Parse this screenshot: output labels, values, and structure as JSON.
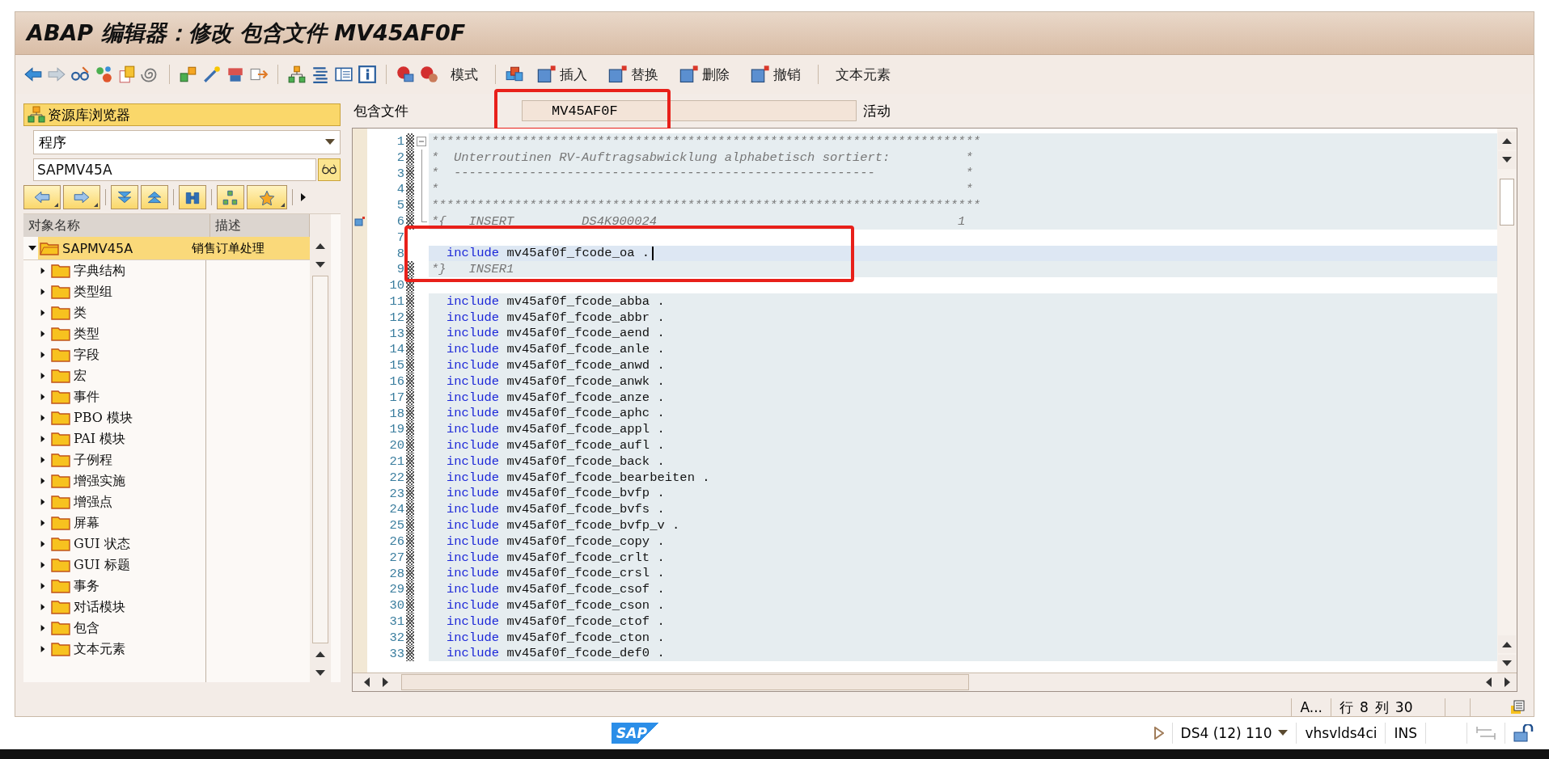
{
  "window": {
    "title": "ABAP 编辑器：修改 包含文件 MV45AF0F"
  },
  "toolbar": {
    "buttons": [
      {
        "kind": "text",
        "label": "模式"
      },
      {
        "kind": "icon_text",
        "label": "插入"
      },
      {
        "kind": "icon_text",
        "label": "替换"
      },
      {
        "kind": "icon_text",
        "label": "删除"
      },
      {
        "kind": "icon_text",
        "label": "撤销"
      },
      {
        "kind": "text",
        "label": "文本元素"
      }
    ]
  },
  "repository_browser": {
    "title": "资源库浏览器",
    "object_type": "程序",
    "object_name": "SAPMV45A",
    "columns": [
      "对象名称",
      "描述"
    ],
    "tree": [
      {
        "label": "SAPMV45A",
        "description": "销售订单处理",
        "expanded": true,
        "selected": true,
        "children": [
          {
            "label": "字典结构",
            "expanded": false,
            "selected": false
          },
          {
            "label": "类型组",
            "expanded": false,
            "selected": false
          },
          {
            "label": "类",
            "expanded": false,
            "selected": false
          },
          {
            "label": "类型",
            "expanded": false,
            "selected": false
          },
          {
            "label": "字段",
            "expanded": false,
            "selected": false
          },
          {
            "label": "宏",
            "expanded": false,
            "selected": false
          },
          {
            "label": "事件",
            "expanded": false,
            "selected": false
          },
          {
            "label": "PBO 模块",
            "expanded": false,
            "selected": false
          },
          {
            "label": "PAI 模块",
            "expanded": false,
            "selected": false
          },
          {
            "label": "子例程",
            "expanded": false,
            "selected": false
          },
          {
            "label": "增强实施",
            "expanded": false,
            "selected": false
          },
          {
            "label": "增强点",
            "expanded": false,
            "selected": false
          },
          {
            "label": "屏幕",
            "expanded": false,
            "selected": false
          },
          {
            "label": "GUI 状态",
            "expanded": false,
            "selected": false
          },
          {
            "label": "GUI 标题",
            "expanded": false,
            "selected": false
          },
          {
            "label": "事务",
            "expanded": false,
            "selected": false
          },
          {
            "label": "对话模块",
            "expanded": false,
            "selected": false
          },
          {
            "label": "包含",
            "expanded": false,
            "selected": false
          },
          {
            "label": "文本元素",
            "expanded": false,
            "selected": false
          }
        ]
      }
    ]
  },
  "editor": {
    "field_label": "包含文件",
    "field_value": "MV45AF0F",
    "status": "活动",
    "lines": [
      {
        "number": "1",
        "kind": "comment",
        "text": "*************************************************************************",
        "current": false,
        "modified": false
      },
      {
        "number": "2",
        "kind": "comment",
        "text": "*  Unterroutinen RV-Auftragsabwicklung alphabetisch sortiert:          *",
        "current": false,
        "modified": false
      },
      {
        "number": "3",
        "kind": "comment",
        "text": "*  --------------------------------------------------------            *",
        "current": false,
        "modified": false
      },
      {
        "number": "4",
        "kind": "comment",
        "text": "*                                                                      *",
        "current": false,
        "modified": false
      },
      {
        "number": "5",
        "kind": "comment",
        "text": "*************************************************************************",
        "current": false,
        "modified": false
      },
      {
        "number": "6",
        "kind": "comment",
        "text": "*{   INSERT         DS4K900024                                        1",
        "current": false,
        "modified": false
      },
      {
        "number": "7",
        "kind": "blank",
        "current": false,
        "modified": true
      },
      {
        "number": "8",
        "kind": "include",
        "keyword": "include",
        "text": "mv45af0f_fcode_oa .",
        "current": true,
        "modified": true
      },
      {
        "number": "9",
        "kind": "comment",
        "text": "*}   INSER1",
        "current": false,
        "modified": false
      },
      {
        "number": "10",
        "kind": "blank",
        "current": false,
        "modified": false
      },
      {
        "number": "11",
        "kind": "include",
        "keyword": "include",
        "text": "mv45af0f_fcode_abba .",
        "current": false,
        "modified": false
      },
      {
        "number": "12",
        "kind": "include",
        "keyword": "include",
        "text": "mv45af0f_fcode_abbr .",
        "current": false,
        "modified": false
      },
      {
        "number": "13",
        "kind": "include",
        "keyword": "include",
        "text": "mv45af0f_fcode_aend .",
        "current": false,
        "modified": false
      },
      {
        "number": "14",
        "kind": "include",
        "keyword": "include",
        "text": "mv45af0f_fcode_anle .",
        "current": false,
        "modified": false
      },
      {
        "number": "15",
        "kind": "include",
        "keyword": "include",
        "text": "mv45af0f_fcode_anwd .",
        "current": false,
        "modified": false
      },
      {
        "number": "16",
        "kind": "include",
        "keyword": "include",
        "text": "mv45af0f_fcode_anwk .",
        "current": false,
        "modified": false
      },
      {
        "number": "17",
        "kind": "include",
        "keyword": "include",
        "text": "mv45af0f_fcode_anze .",
        "current": false,
        "modified": false
      },
      {
        "number": "18",
        "kind": "include",
        "keyword": "include",
        "text": "mv45af0f_fcode_aphc .",
        "current": false,
        "modified": false
      },
      {
        "number": "19",
        "kind": "include",
        "keyword": "include",
        "text": "mv45af0f_fcode_appl .",
        "current": false,
        "modified": false
      },
      {
        "number": "20",
        "kind": "include",
        "keyword": "include",
        "text": "mv45af0f_fcode_aufl .",
        "current": false,
        "modified": false
      },
      {
        "number": "21",
        "kind": "include",
        "keyword": "include",
        "text": "mv45af0f_fcode_back .",
        "current": false,
        "modified": false
      },
      {
        "number": "22",
        "kind": "include",
        "keyword": "include",
        "text": "mv45af0f_fcode_bearbeiten .",
        "current": false,
        "modified": false
      },
      {
        "number": "23",
        "kind": "include",
        "keyword": "include",
        "text": "mv45af0f_fcode_bvfp .",
        "current": false,
        "modified": false
      },
      {
        "number": "24",
        "kind": "include",
        "keyword": "include",
        "text": "mv45af0f_fcode_bvfs .",
        "current": false,
        "modified": false
      },
      {
        "number": "25",
        "kind": "include",
        "keyword": "include",
        "text": "mv45af0f_fcode_bvfp_v .",
        "current": false,
        "modified": false
      },
      {
        "number": "26",
        "kind": "include",
        "keyword": "include",
        "text": "mv45af0f_fcode_copy .",
        "current": false,
        "modified": false
      },
      {
        "number": "27",
        "kind": "include",
        "keyword": "include",
        "text": "mv45af0f_fcode_crlt .",
        "current": false,
        "modified": false
      },
      {
        "number": "28",
        "kind": "include",
        "keyword": "include",
        "text": "mv45af0f_fcode_crsl .",
        "current": false,
        "modified": false
      },
      {
        "number": "29",
        "kind": "include",
        "keyword": "include",
        "text": "mv45af0f_fcode_csof .",
        "current": false,
        "modified": false
      },
      {
        "number": "30",
        "kind": "include",
        "keyword": "include",
        "text": "mv45af0f_fcode_cson .",
        "current": false,
        "modified": false
      },
      {
        "number": "31",
        "kind": "include",
        "keyword": "include",
        "text": "mv45af0f_fcode_ctof .",
        "current": false,
        "modified": false
      },
      {
        "number": "32",
        "kind": "include",
        "keyword": "include",
        "text": "mv45af0f_fcode_cton .",
        "current": false,
        "modified": false
      },
      {
        "number": "33",
        "kind": "include",
        "keyword": "include",
        "text": "mv45af0f_fcode_def0 .",
        "current": false,
        "modified": false
      }
    ]
  },
  "status_bar": {
    "message": "A...",
    "line_label": "行",
    "line": "8",
    "column_label": "列",
    "column": "30"
  },
  "system_bar": {
    "logo": "SAP",
    "system": "DS4 (12) 110",
    "server": "vhsvlds4ci",
    "mode": "INS"
  }
}
